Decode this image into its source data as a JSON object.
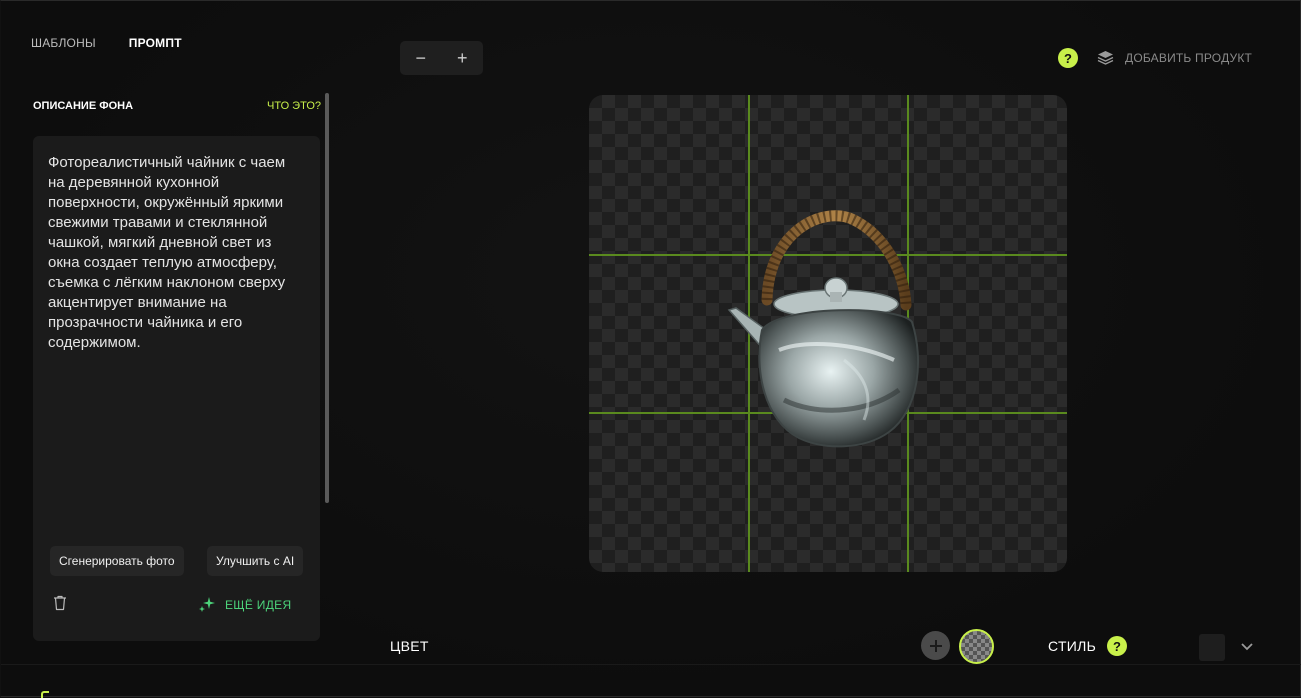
{
  "tabs": [
    {
      "label": "ШАБЛОНЫ",
      "active": false
    },
    {
      "label": "ПРОМПТ",
      "active": true
    }
  ],
  "panel": {
    "title": "ОПИСАНИЕ ФОНА",
    "help_link": "ЧТО ЭТО?",
    "prompt_text": "Фотореалистичный чайник с чаем на деревянной кухонной поверхности, окружённый яркими свежими травами и стеклянной чашкой, мягкий дневной свет из окна создает теплую атмосферу, съемка с лёгким наклоном сверху акцентирует внимание на прозрачности чайника и его содержимом.",
    "generate_label": "Сгенерировать фото",
    "improve_label": "Улучшить с AI",
    "more_ideas_label": "ЕЩЁ ИДЕЯ"
  },
  "zoom": {
    "minus": "−",
    "plus": "+"
  },
  "header": {
    "help_icon": "?",
    "add_product_label": "ДОБАВИТЬ ПРОДУКТ"
  },
  "bottom": {
    "color_label": "ЦВЕТ",
    "style_label": "СТИЛЬ",
    "style_help": "?"
  },
  "colors": {
    "accent": "#c8f04a",
    "ideas": "#4cd37a",
    "guide": "#5a8a1e",
    "background": "#0f0f0f"
  },
  "icons": [
    "trash-icon",
    "sparkle-icon",
    "layers-icon",
    "help-icon",
    "plus-icon",
    "transparent-swatch-icon",
    "chevron-down-icon"
  ]
}
